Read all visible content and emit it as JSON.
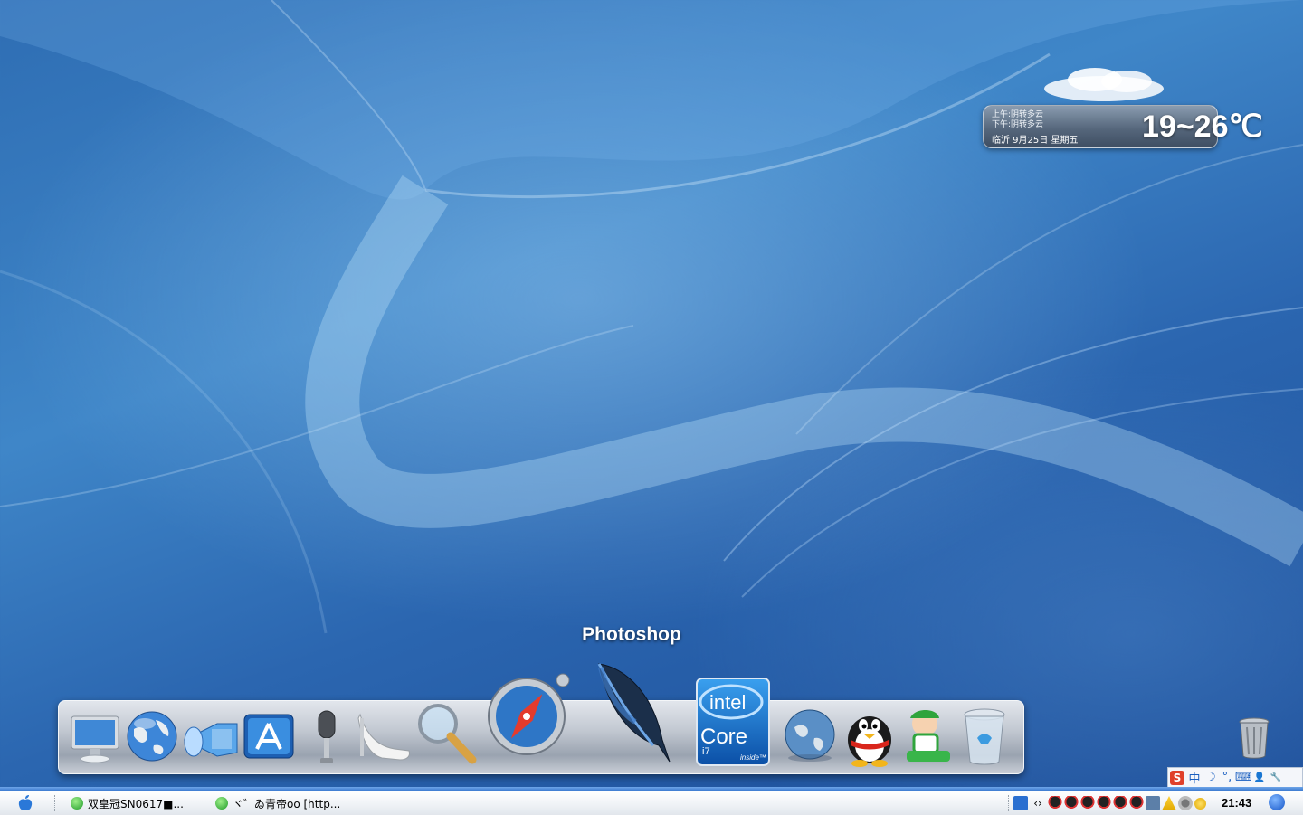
{
  "weather": {
    "morning": "上午:阴转多云",
    "afternoon": "下午:阴转多云",
    "city_date": "临沂  9月25日  星期五",
    "temperature": "19~26℃"
  },
  "dock": {
    "hover_label": "Photoshop",
    "items": [
      {
        "name": "display-monitor-icon"
      },
      {
        "name": "globe-icon"
      },
      {
        "name": "flashlight-icon"
      },
      {
        "name": "app-store-icon"
      },
      {
        "name": "microphone-icon"
      },
      {
        "name": "high-heel-icon"
      },
      {
        "name": "magnifier-icon"
      },
      {
        "name": "safari-compass-icon"
      },
      {
        "name": "photoshop-feather-icon"
      },
      {
        "name": "intel-core-i7-icon"
      },
      {
        "name": "earth-globe-icon"
      },
      {
        "name": "qq-penguin-icon"
      },
      {
        "name": "mascot-icon"
      },
      {
        "name": "trash-icon"
      }
    ]
  },
  "intel_badge": {
    "brand": "intel",
    "line": "Core",
    "model": "i7",
    "tag": "inside™"
  },
  "ime": {
    "logo": "S",
    "mode": "中",
    "moon": "☽",
    "punct": "°,",
    "keyboard": "⌨",
    "user": "👤",
    "tool": "🔧"
  },
  "taskbar": {
    "tasks": [
      {
        "label": "双皇冠SN0617■..."
      },
      {
        "label": "ヾ゛ゐ青帝oo [http..."
      }
    ],
    "clock": "21:43"
  },
  "colors": {
    "taskbar_accent": "#3d7bd0",
    "desktop_bg": "#2e6db3"
  }
}
